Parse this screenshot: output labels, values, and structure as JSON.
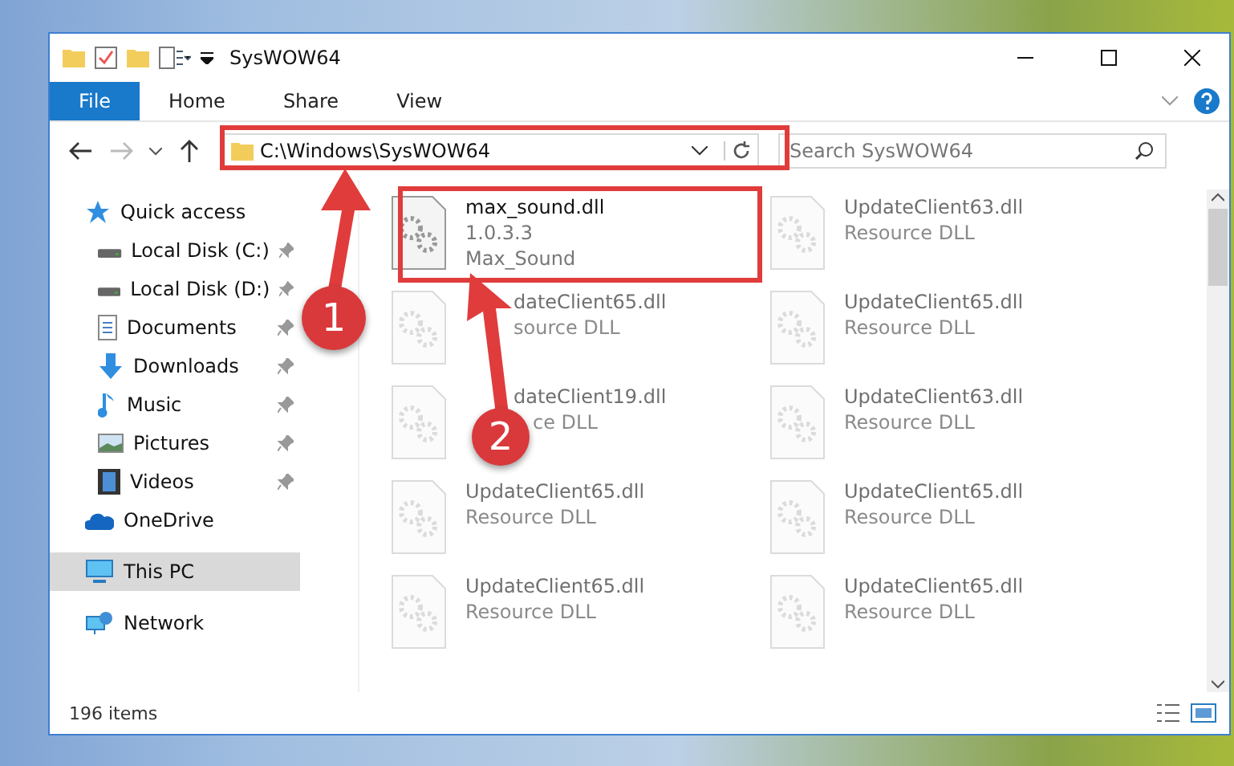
{
  "window": {
    "title": "SysWOW64"
  },
  "ribbon_tabs": [
    {
      "label": "File",
      "kind": "file",
      "selected": false
    },
    {
      "label": "Home",
      "kind": "tab",
      "selected": false
    },
    {
      "label": "Share",
      "kind": "tab",
      "selected": false
    },
    {
      "label": "View",
      "kind": "tab",
      "selected": false
    }
  ],
  "address": {
    "value": "C:\\Windows\\SysWOW64"
  },
  "search": {
    "placeholder": "Search SysWOW64"
  },
  "sidebar": {
    "items": [
      {
        "label": "Quick access",
        "kind": "star",
        "selected": false,
        "children": [
          {
            "label": "Local Disk (C:)",
            "kind": "drive",
            "pinned": true,
            "selected": false
          },
          {
            "label": "Local Disk (D:)",
            "kind": "drive",
            "pinned": true,
            "selected": false
          },
          {
            "label": "Documents",
            "kind": "doc",
            "pinned": true,
            "selected": false
          },
          {
            "label": "Downloads",
            "kind": "download",
            "pinned": true,
            "selected": false
          },
          {
            "label": "Music",
            "kind": "music",
            "pinned": true,
            "selected": false
          },
          {
            "label": "Pictures",
            "kind": "pictures",
            "pinned": true,
            "selected": false
          },
          {
            "label": "Videos",
            "kind": "videos",
            "pinned": true,
            "selected": false
          }
        ]
      },
      {
        "label": "OneDrive",
        "kind": "cloud",
        "selected": false
      },
      {
        "label": "This PC",
        "kind": "pc",
        "selected": true
      },
      {
        "label": "Network",
        "kind": "network",
        "selected": false
      }
    ]
  },
  "files": [
    {
      "name": {
        "text": "max_sound.dll",
        "under_arrow": false,
        "under_marker": false
      },
      "lines": [
        {
          "text": "1.0.3.3",
          "under_arrow": false,
          "under_marker": false
        },
        {
          "text": "Max_Sound",
          "under_arrow": false,
          "under_marker": false
        }
      ],
      "blurred": false
    },
    {
      "name": {
        "text": "UpdateClient63.dll",
        "under_arrow": false,
        "under_marker": false
      },
      "lines": [
        {
          "text": "Resource DLL",
          "under_arrow": false,
          "under_marker": false
        }
      ],
      "blurred": true
    },
    {
      "name": {
        "text": "dateClient65.dll",
        "under_arrow": true,
        "under_marker": false
      },
      "lines": [
        {
          "text": "source DLL",
          "under_arrow": true,
          "under_marker": false
        }
      ],
      "blurred": true
    },
    {
      "name": {
        "text": "UpdateClient65.dll",
        "under_arrow": false,
        "under_marker": false
      },
      "lines": [
        {
          "text": "Resource DLL",
          "under_arrow": false,
          "under_marker": false
        }
      ],
      "blurred": true
    },
    {
      "name": {
        "text": "dateClient19.dll",
        "under_arrow": true,
        "under_marker": false
      },
      "lines": [
        {
          "text": "ce DLL",
          "under_arrow": false,
          "under_marker": true
        }
      ],
      "blurred": true
    },
    {
      "name": {
        "text": "UpdateClient63.dll",
        "under_arrow": false,
        "under_marker": false
      },
      "lines": [
        {
          "text": "Resource DLL",
          "under_arrow": false,
          "under_marker": false
        }
      ],
      "blurred": true
    },
    {
      "name": {
        "text": "UpdateClient65.dll",
        "under_arrow": false,
        "under_marker": false
      },
      "lines": [
        {
          "text": "Resource DLL",
          "under_arrow": false,
          "under_marker": false
        }
      ],
      "blurred": true
    },
    {
      "name": {
        "text": "UpdateClient65.dll",
        "under_arrow": false,
        "under_marker": false
      },
      "lines": [
        {
          "text": "Resource DLL",
          "under_arrow": false,
          "under_marker": false
        }
      ],
      "blurred": true
    },
    {
      "name": {
        "text": "UpdateClient65.dll",
        "under_arrow": false,
        "under_marker": false
      },
      "lines": [
        {
          "text": "Resource DLL",
          "under_arrow": false,
          "under_marker": false
        }
      ],
      "blurred": true
    },
    {
      "name": {
        "text": "UpdateClient65.dll",
        "under_arrow": false,
        "under_marker": false
      },
      "lines": [
        {
          "text": "Resource DLL",
          "under_arrow": false,
          "under_marker": false
        }
      ],
      "blurred": true
    }
  ],
  "status_bar": {
    "count": "196 items"
  },
  "annotations": {
    "markers": [
      {
        "label": "1"
      },
      {
        "label": "2"
      }
    ]
  }
}
